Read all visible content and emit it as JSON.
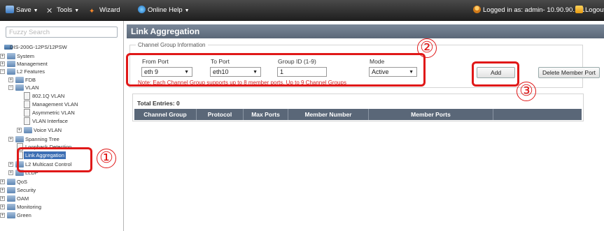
{
  "toolbar": {
    "save": "Save",
    "tools": "Tools",
    "wizard": "Wizard",
    "online_help": "Online Help",
    "logged_in": "Logged in as: admin- 10.90.90.111",
    "logout": "Logout"
  },
  "sidebar": {
    "search_placeholder": "Fuzzy Search",
    "device": "DIS-200G-12PS/12PSW",
    "items": {
      "system": "System",
      "management": "Management",
      "l2_features": "L2 Features",
      "fdb": "FDB",
      "vlan": "VLAN",
      "vlan_8021q": "802.1Q VLAN",
      "management_vlan": "Management VLAN",
      "asymmetric_vlan": "Asymmetric VLAN",
      "vlan_interface": "VLAN Interface",
      "voice_vlan": "Voice VLAN",
      "spanning_tree": "Spanning Tree",
      "loopback_detection": "Loopback Detection",
      "link_aggregation": "Link Aggregation",
      "l2_multicast_control": "L2 Multicast Control",
      "lldp": "LLDP",
      "qos": "QoS",
      "security": "Security",
      "oam": "OAM",
      "monitoring": "Monitoring",
      "green": "Green"
    }
  },
  "main": {
    "title": "Link Aggregation",
    "group_legend": "Channel Group Information",
    "from_port_label": "From Port",
    "from_port_value": "eth 9",
    "to_port_label": "To Port",
    "to_port_value": "eth10",
    "group_id_label": "Group ID (1-9)",
    "group_id_value": "1",
    "mode_label": "Mode",
    "mode_value": "Active",
    "note": "Note: Each Channel Group supports up to 8  member ports.  Up to 9  Channel Groups",
    "add_button": "Add",
    "delete_button": "Delete Member Port",
    "total_entries": "Total Entries: 0",
    "columns": [
      "Channel Group",
      "Protocol",
      "Max Ports",
      "Member Number",
      "Member Ports"
    ]
  },
  "annotations": {
    "step1": "①",
    "step2": "②",
    "step3": "③"
  },
  "colors": {
    "annotation_red": "#e01818",
    "header_slate": "#5a6778",
    "selected_blue": "#3d6fb4"
  }
}
